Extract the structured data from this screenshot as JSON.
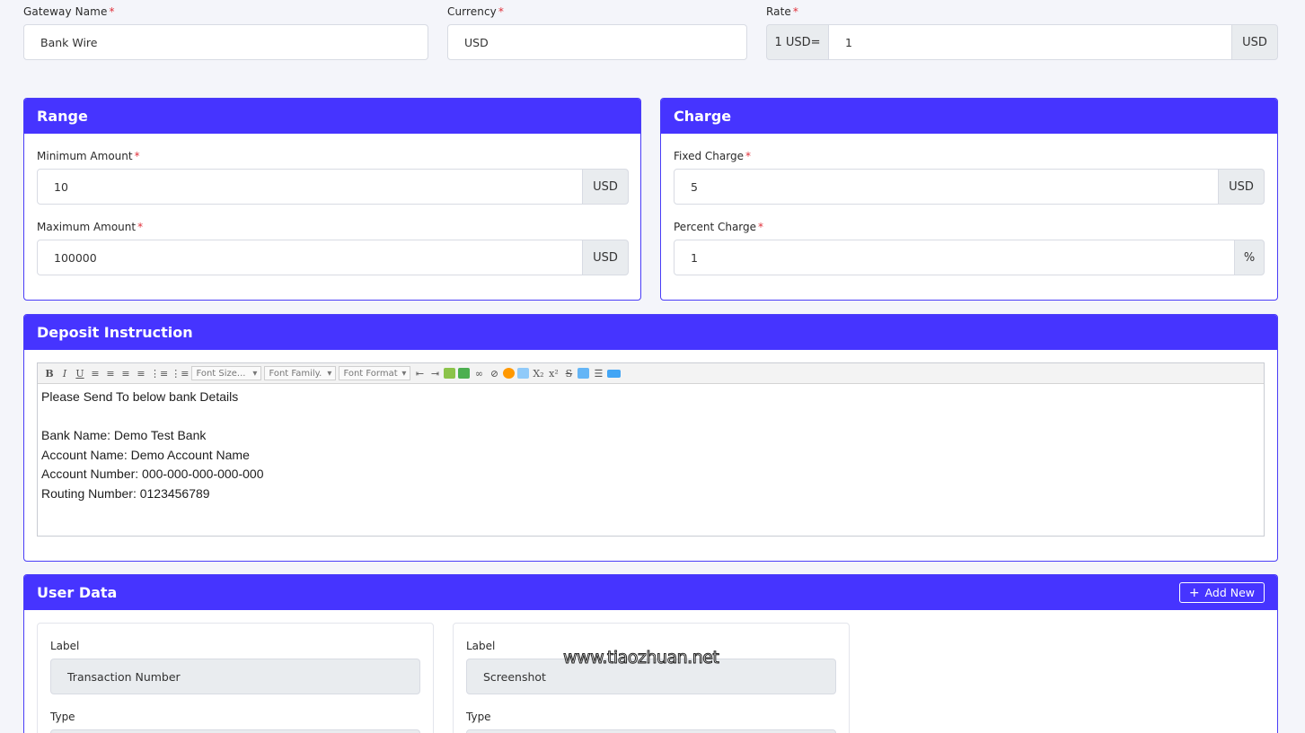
{
  "gateway": {
    "name_label": "Gateway Name",
    "name_value": "Bank Wire",
    "currency_label": "Currency",
    "currency_value": "USD",
    "rate_label": "Rate",
    "rate_prefix": "1 USD=",
    "rate_value": "1",
    "rate_suffix": "USD",
    "required_mark": "*"
  },
  "range": {
    "title": "Range",
    "min_label": "Minimum Amount",
    "min_value": "10",
    "min_unit": "USD",
    "max_label": "Maximum Amount",
    "max_value": "100000",
    "max_unit": "USD"
  },
  "charge": {
    "title": "Charge",
    "fixed_label": "Fixed Charge",
    "fixed_value": "5",
    "fixed_unit": "USD",
    "percent_label": "Percent Charge",
    "percent_value": "1",
    "percent_unit": "%"
  },
  "deposit": {
    "title": "Deposit Instruction",
    "toolbar": {
      "bold": "B",
      "italic": "I",
      "underline": "U",
      "font_size": "Font Size...",
      "font_family": "Font Family.",
      "font_format": "Font Format",
      "subscript": "X₂",
      "superscript": "x²",
      "strike": "S"
    },
    "lines": [
      "Please Send To below bank Details",
      "",
      "Bank Name: Demo Test Bank",
      "Account Name: Demo Account Name",
      "Account Number: 000-000-000-000-000",
      "Routing Number: 0123456789"
    ]
  },
  "user_data": {
    "title": "User Data",
    "add_new": "Add New",
    "add_icon": "plus-icon",
    "fields": [
      {
        "label_caption": "Label",
        "label_value": "Transaction Number",
        "type_caption": "Type"
      },
      {
        "label_caption": "Label",
        "label_value": "Screenshot",
        "type_caption": "Type"
      }
    ]
  },
  "watermark": "www.tiaozhuan.net",
  "colors": {
    "accent": "#4634ff",
    "required": "#e0303a",
    "page_bg": "#f4f5fa",
    "readonly_bg": "#e9ecef"
  }
}
